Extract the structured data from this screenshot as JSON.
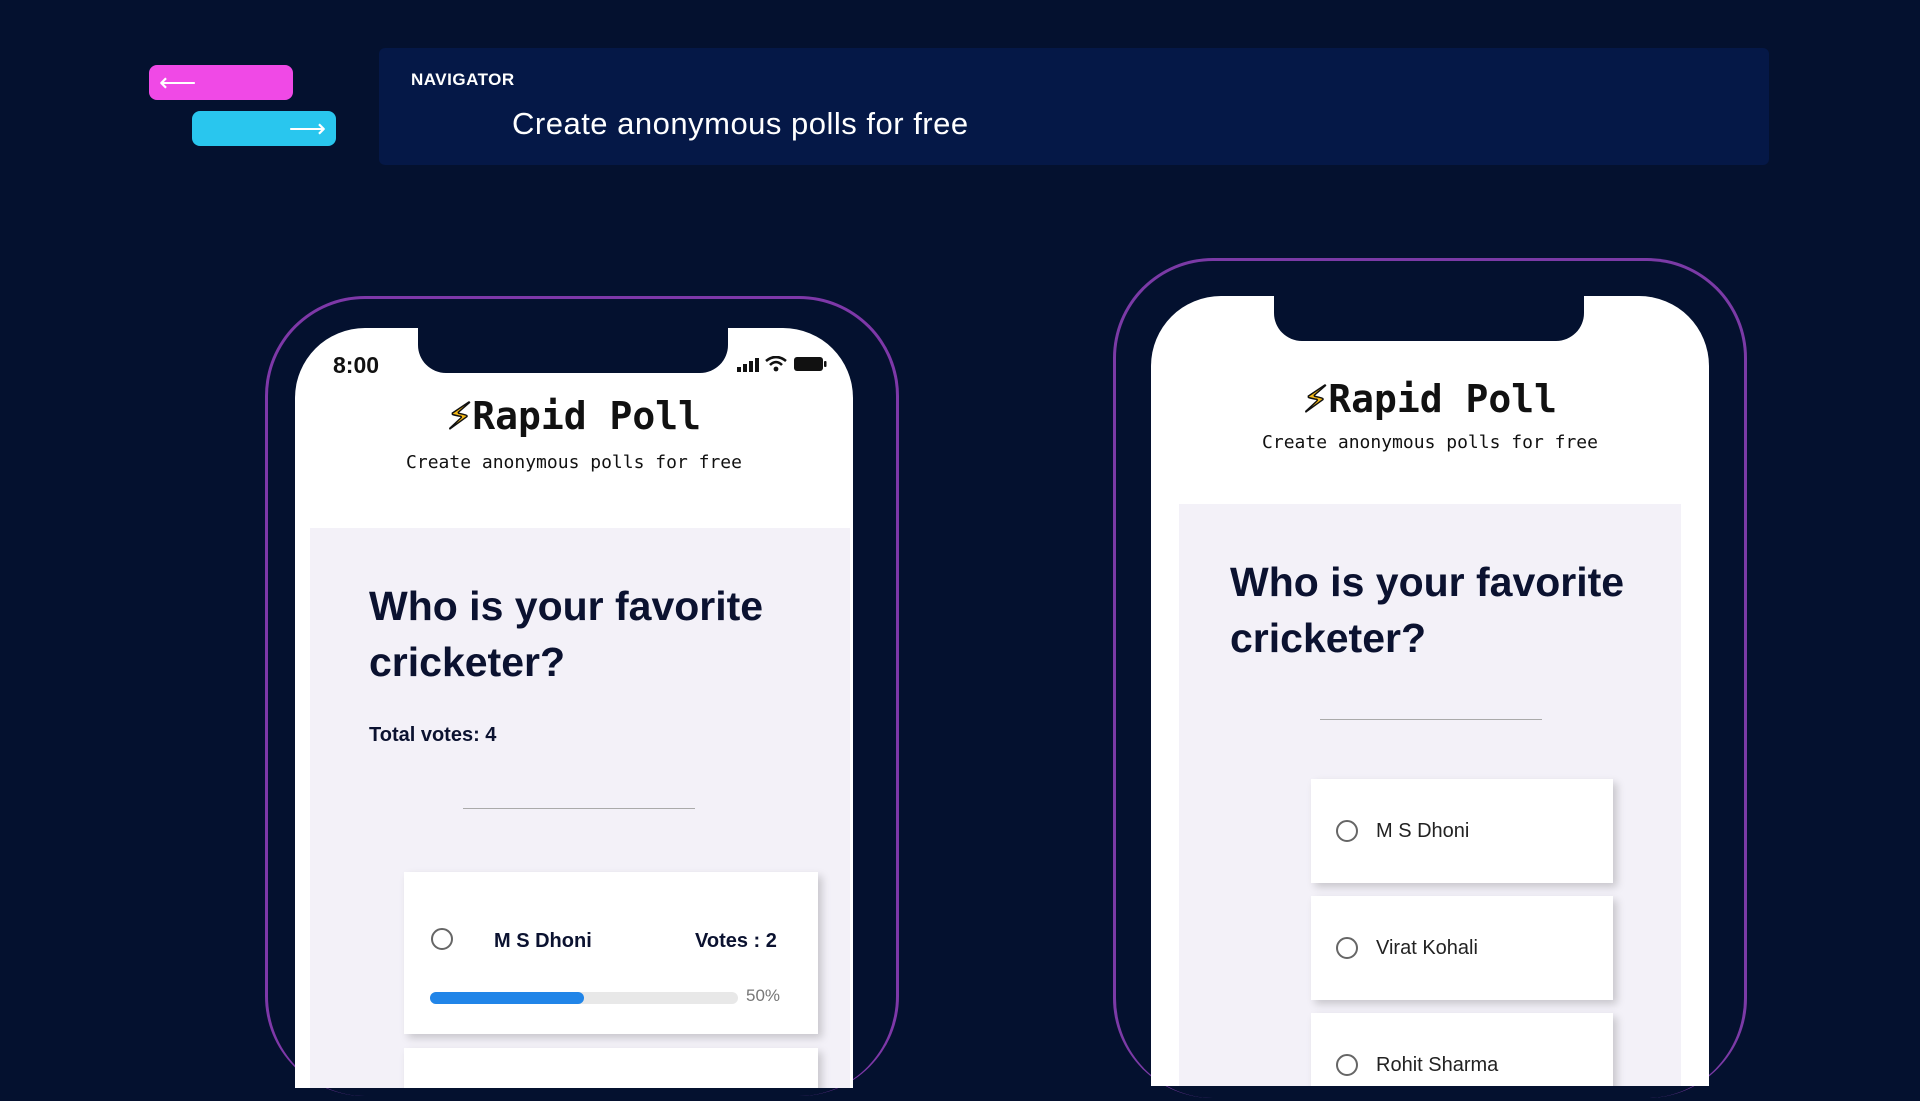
{
  "navigator": {
    "label": "NAVIGATOR",
    "title": "Create anonymous polls for free",
    "back_icon": "arrow-left",
    "forward_icon": "arrow-right",
    "back_color": "#f049e6",
    "forward_color": "#29c6ee"
  },
  "left_phone": {
    "time": "8:00",
    "app_title": "Rapid Poll",
    "app_subtitle": "Create anonymous polls for free",
    "question": "Who is your favorite cricketer?",
    "total_votes": "Total votes: 4",
    "options": [
      {
        "label": "M S Dhoni",
        "votes": "Votes : 2",
        "percent_text": "50%",
        "percent": 50
      }
    ]
  },
  "right_phone": {
    "app_title": "Rapid Poll",
    "app_subtitle": "Create anonymous polls for free",
    "question": "Who is your favorite cricketer?",
    "options": [
      {
        "label": "M S Dhoni"
      },
      {
        "label": "Virat Kohali"
      },
      {
        "label": "Rohit Sharma"
      }
    ]
  },
  "colors": {
    "background": "#04112f",
    "phone_frame": "#7b3aa6",
    "progress_fill": "#2185e8",
    "bolt": "#f5b915"
  }
}
